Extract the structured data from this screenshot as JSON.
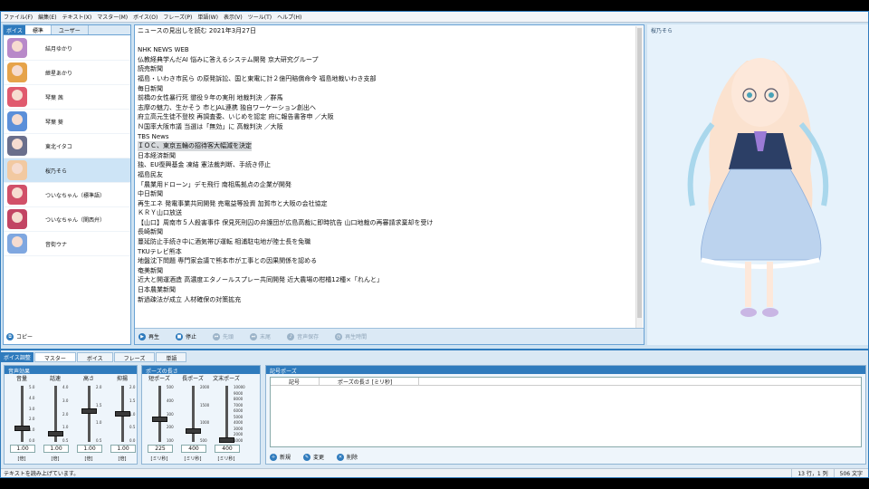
{
  "menu": [
    "ファイル(F)",
    "編集(E)",
    "テキスト(X)",
    "マスター(M)",
    "ボイス(O)",
    "フレーズ(P)",
    "単語(W)",
    "表示(V)",
    "ツール(T)",
    "ヘルプ(H)"
  ],
  "voice_panel": {
    "head": "ボイス",
    "tabs": [
      "標準",
      "ユーザー"
    ],
    "items": [
      {
        "name": "結月ゆかり",
        "color": "#b889c9"
      },
      {
        "name": "紲星あかり",
        "color": "#e6a34a"
      },
      {
        "name": "琴葉 茜",
        "color": "#e05a6e"
      },
      {
        "name": "琴葉 葵",
        "color": "#5b8fd9"
      },
      {
        "name": "東北イタコ",
        "color": "#6a6f8c"
      },
      {
        "name": "桜乃そら",
        "color": "#f2c9a1",
        "selected": true
      },
      {
        "name": "ついなちゃん（標準語）",
        "color": "#d15068"
      },
      {
        "name": "ついなちゃん（関西弁）",
        "color": "#c24463"
      },
      {
        "name": "音街ウナ",
        "color": "#7fa7e0"
      }
    ],
    "copy": "コピー"
  },
  "editor": {
    "lines": [
      "ニュースの見出しを読む 2021年3月27日",
      "",
      "NHK NEWS WEB",
      "仏教経典学んだAI 悩みに答えるシステム開発 京大研究グループ",
      "読売新聞",
      "福島・いわき市民ら の原発訴訟、国と東電に計２億円賠償命令 福島地裁いわき支部",
      "毎日新聞",
      "前橋の女性暴行死 懲役９年の実刑 地裁判決 ／群馬",
      "志摩の魅力、生かそう 市とJAL連携 独自ワーケーション創出へ",
      "府立高元生徒不登校 再調査委、いじめを認定 府に報告書答申 ／大阪",
      "Ｎ国率大阪市議 当選は「無効」に 高裁判決 ／大阪",
      "TBS News",
      "ＩＯＣ、東京五輪の招待客大幅減を決定",
      "日本経済新聞",
      "独、EU復興基金 凍結 憲法裁判断、手続き停止",
      "福島民友",
      "「農業用ドローン」デモ飛行 南相馬拠点の企業が開発",
      "中日新聞",
      "再生エネ 発電事業共同開発 売電益等投資 加賀市と大阪の会社協定",
      "ＫＲＹ山口放送",
      "【山口】周南市５人殺害事件 保見死刑囚の弁護団が広島高裁に即時抗告 山口地裁の再審請求棄却を受け",
      "長崎新聞",
      "蔓延防止手続き中に酒気帯び運転 相浦駐屯地が陸士長を免職",
      "TKUテレビ熊本",
      "地盤沈下問題 専門家会議で熊本市が工事との因果関係を認める",
      "奄美新聞",
      "近大と開運酒造 高濃度エタノールスプレー共同開発 近大農場の柑橘12種×「れんと」",
      "日本農業新聞",
      "新過疎法が成立 人材確保の対策拡充"
    ],
    "highlight_line": 12,
    "buttons": {
      "play": "再生",
      "stop": "停止",
      "prev": "先頭",
      "next": "末尾",
      "save": "音声保存",
      "time": "再生時間"
    }
  },
  "character": {
    "name": "桜乃そら"
  },
  "tuning": {
    "head": "ボイス調整",
    "tabs": [
      "マスター",
      "ボイス",
      "フレーズ",
      "単語"
    ],
    "effects_group": "音声効果",
    "pause_group": "ポーズの長さ",
    "sliders": [
      {
        "label": "音量",
        "value": "1.00",
        "unit": "[倍]",
        "level": 0.25,
        "ticks": [
          "5.0",
          "4.0",
          "3.0",
          "2.0",
          "1.0",
          "0.0"
        ]
      },
      {
        "label": "話速",
        "value": "1.00",
        "unit": "[倍]",
        "level": 0.14,
        "ticks": [
          "4.0",
          "3.0",
          "2.0",
          "1.0",
          "0.5"
        ]
      },
      {
        "label": "高さ",
        "value": "1.00",
        "unit": "[倍]",
        "level": 0.55,
        "ticks": [
          "2.0",
          "1.5",
          "1.0",
          "0.5"
        ]
      },
      {
        "label": "抑揚",
        "value": "1.00",
        "unit": "[倍]",
        "level": 0.5,
        "ticks": [
          "2.0",
          "1.5",
          "1.0",
          "0.5",
          "0.0"
        ]
      },
      {
        "label": "短ポーズ",
        "value": "225",
        "unit": "[ミリ秒]",
        "level": 0.4,
        "ticks": [
          "500",
          "400",
          "300",
          "200",
          "100"
        ]
      },
      {
        "label": "長ポーズ",
        "value": "400",
        "unit": "[ミリ秒]",
        "level": 0.2,
        "ticks": [
          "2000",
          "1500",
          "1000",
          "500"
        ]
      },
      {
        "label": "文末ポーズ",
        "value": "400",
        "unit": "[ミリ秒]",
        "level": 0.04,
        "ticks": [
          "10000",
          "9000",
          "8000",
          "7000",
          "6000",
          "5000",
          "4000",
          "3000",
          "2000",
          "1000"
        ]
      }
    ],
    "symbol_group": "記号ポーズ",
    "columns": [
      "記号",
      "ポーズの長さ [ミリ秒]"
    ],
    "buttons": {
      "new": "新規",
      "edit": "変更",
      "delete": "削除"
    }
  },
  "status": {
    "message": "テキストを読み上げています。",
    "position": "13 行，1 列",
    "chars": "506 文字"
  }
}
